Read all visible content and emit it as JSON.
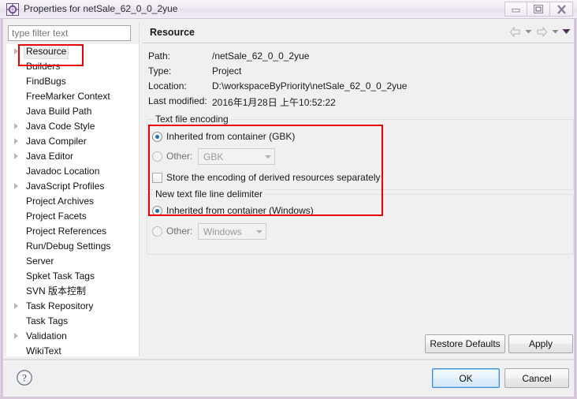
{
  "window": {
    "title": "Properties for netSale_62_0_0_2yue",
    "icon": "eclipse-properties-icon",
    "buttons": {
      "minimize": "minimize-icon",
      "maximize": "maximize-icon",
      "close": "close-icon"
    }
  },
  "filter": {
    "placeholder": "type filter text",
    "value": ""
  },
  "tree": {
    "selected": "Resource",
    "items": [
      {
        "label": "Resource",
        "expandable": true,
        "selected": true
      },
      {
        "label": "Builders",
        "expandable": false,
        "selected": false
      },
      {
        "label": "FindBugs",
        "expandable": false,
        "selected": false
      },
      {
        "label": "FreeMarker Context",
        "expandable": false,
        "selected": false
      },
      {
        "label": "Java Build Path",
        "expandable": false,
        "selected": false
      },
      {
        "label": "Java Code Style",
        "expandable": true,
        "selected": false
      },
      {
        "label": "Java Compiler",
        "expandable": true,
        "selected": false
      },
      {
        "label": "Java Editor",
        "expandable": true,
        "selected": false
      },
      {
        "label": "Javadoc Location",
        "expandable": false,
        "selected": false
      },
      {
        "label": "JavaScript Profiles",
        "expandable": true,
        "selected": false
      },
      {
        "label": "Project Archives",
        "expandable": false,
        "selected": false
      },
      {
        "label": "Project Facets",
        "expandable": false,
        "selected": false
      },
      {
        "label": "Project References",
        "expandable": false,
        "selected": false
      },
      {
        "label": "Run/Debug Settings",
        "expandable": false,
        "selected": false
      },
      {
        "label": "Server",
        "expandable": false,
        "selected": false
      },
      {
        "label": "Spket Task Tags",
        "expandable": false,
        "selected": false
      },
      {
        "label": "SVN 版本控制",
        "expandable": false,
        "selected": false
      },
      {
        "label": "Task Repository",
        "expandable": true,
        "selected": false
      },
      {
        "label": "Task Tags",
        "expandable": false,
        "selected": false
      },
      {
        "label": "Validation",
        "expandable": true,
        "selected": false
      },
      {
        "label": "WikiText",
        "expandable": false,
        "selected": false
      }
    ]
  },
  "content": {
    "title": "Resource",
    "nav": {
      "back": "back-arrow-icon",
      "back_menu": "chevron-down-icon",
      "forward": "forward-arrow-icon",
      "forward_menu": "chevron-down-icon",
      "view_menu": "view-menu-icon"
    },
    "properties": [
      {
        "label": "Path:",
        "value": "/netSale_62_0_0_2yue"
      },
      {
        "label": "Type:",
        "value": "Project"
      },
      {
        "label": "Location:",
        "value": "D:\\workspaceByPriority\\netSale_62_0_0_2yue"
      },
      {
        "label": "Last modified:",
        "value": "2016年1月28日 上午10:52:22"
      }
    ],
    "encoding_group": {
      "legend": "Text file encoding",
      "inherited_label": "Inherited from container (GBK)",
      "inherited_checked": true,
      "other_label": "Other:",
      "other_checked": false,
      "other_value": "GBK",
      "store_derived_label": "Store the encoding of derived resources separately",
      "store_derived_checked": false
    },
    "delimiter_group": {
      "legend": "New text file line delimiter",
      "inherited_label": "Inherited from container (Windows)",
      "inherited_checked": true,
      "other_label": "Other:",
      "other_checked": false,
      "other_value": "Windows"
    },
    "restore_defaults_label": "Restore Defaults",
    "apply_label": "Apply"
  },
  "footer": {
    "help": "help-icon",
    "ok_label": "OK",
    "cancel_label": "Cancel"
  },
  "annotations": {
    "tree_highlight": "red-rectangle-over-resource-builders",
    "encoding_highlight": "red-rectangle-over-encoding-options"
  },
  "colors": {
    "annotation": "#ee0000",
    "accent": "#1f6fb8",
    "default_button_border": "#3c8ddc",
    "panel_bg": "#f0f0f0"
  }
}
